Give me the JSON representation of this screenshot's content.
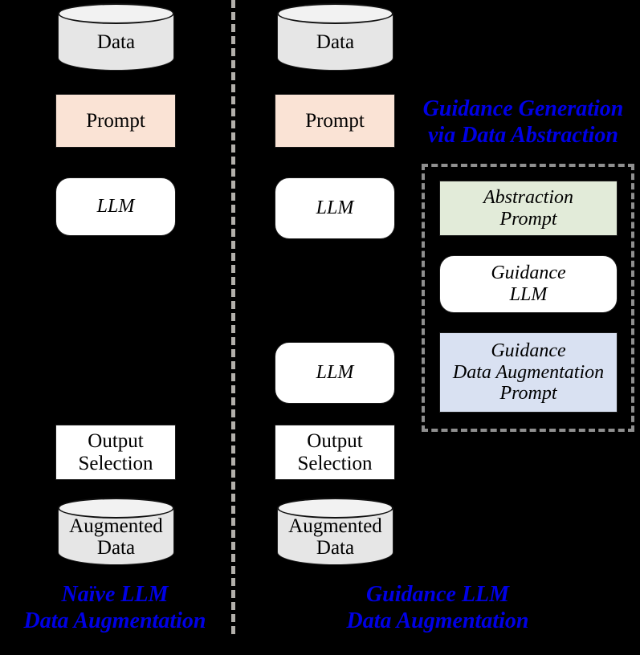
{
  "figure": {
    "background_color": "#000000",
    "accent_caption_color": "#0000e6"
  },
  "divider": {
    "name": "vertical-dashed-divider",
    "color": "#b3b0ab"
  },
  "left_column": {
    "caption": "Naïve LLM\nData Augmentation",
    "nodes": [
      {
        "id": "data",
        "label": "Data",
        "shape": "cylinder",
        "fill": "#e6e6e6"
      },
      {
        "id": "prompt",
        "label": "Prompt",
        "shape": "rect",
        "fill": "#fae3d5"
      },
      {
        "id": "llm",
        "label": "LLM",
        "shape": "rounded",
        "fill": "#ffffff"
      },
      {
        "id": "output_selection",
        "label": "Output\nSelection",
        "shape": "rect",
        "fill": "#ffffff"
      },
      {
        "id": "augmented_data",
        "label": "Augmented\nData",
        "shape": "cylinder",
        "fill": "#e6e6e6"
      }
    ]
  },
  "right_column": {
    "caption": "Guidance LLM\nData Augmentation",
    "nodes": [
      {
        "id": "data",
        "label": "Data",
        "shape": "cylinder",
        "fill": "#e6e6e6"
      },
      {
        "id": "prompt",
        "label": "Prompt",
        "shape": "rect",
        "fill": "#fae3d5"
      },
      {
        "id": "llm_1",
        "label": "LLM",
        "shape": "rounded",
        "fill": "#ffffff"
      },
      {
        "id": "llm_2",
        "label": "LLM",
        "shape": "rounded",
        "fill": "#ffffff"
      },
      {
        "id": "output_selection",
        "label": "Output\nSelection",
        "shape": "rect",
        "fill": "#ffffff"
      },
      {
        "id": "augmented_data",
        "label": "Augmented\nData",
        "shape": "cylinder",
        "fill": "#e6e6e6"
      }
    ]
  },
  "guidance_group": {
    "heading": "Guidance Generation\nvia Data Abstraction",
    "border_color": "#8f8f8f",
    "nodes": [
      {
        "id": "abstraction_prompt",
        "label": "Abstraction\nPrompt",
        "shape": "rect",
        "fill": "#e2ebd9"
      },
      {
        "id": "guidance_llm",
        "label": "Guidance\nLLM",
        "shape": "rounded",
        "fill": "#ffffff"
      },
      {
        "id": "guidance_da_prompt",
        "label": "Guidance\nData Augmentation\nPrompt",
        "shape": "rect",
        "fill": "#d9e1f2"
      }
    ]
  }
}
